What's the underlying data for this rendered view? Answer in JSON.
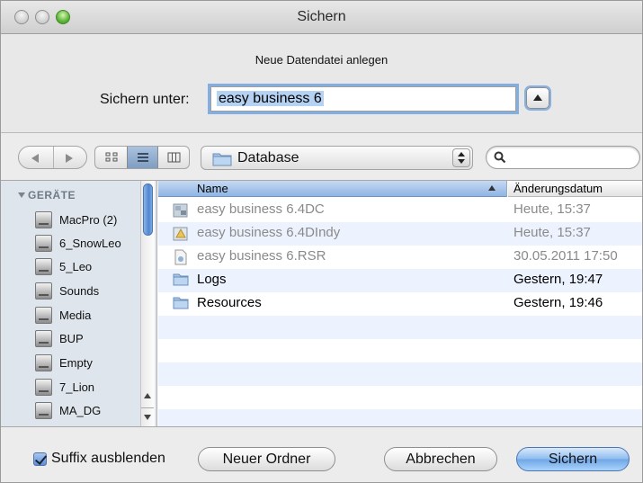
{
  "window": {
    "title": "Sichern"
  },
  "header": {
    "message": "Neue Datendatei anlegen",
    "save_as_label": "Sichern unter:",
    "save_as_value": "easy business 6"
  },
  "toolbar": {
    "view_icons": [
      "icon-view",
      "list-view",
      "column-view"
    ],
    "path_popup_label": "Database",
    "search_placeholder": ""
  },
  "sidebar": {
    "section_title": "GERÄTE",
    "items": [
      {
        "label": "MacPro (2)"
      },
      {
        "label": "6_SnowLeo"
      },
      {
        "label": "5_Leo"
      },
      {
        "label": "Sounds"
      },
      {
        "label": "Media"
      },
      {
        "label": "BUP"
      },
      {
        "label": "Empty"
      },
      {
        "label": "7_Lion"
      },
      {
        "label": "MA_DG"
      }
    ]
  },
  "file_list": {
    "columns": {
      "name": "Name",
      "date": "Änderungsdatum"
    },
    "rows": [
      {
        "name": "easy business 6.4DC",
        "date": "Heute, 15:37",
        "icon": "4d-component-icon",
        "enabled": false
      },
      {
        "name": "easy business 6.4DIndy",
        "date": "Heute, 15:37",
        "icon": "4d-indy-icon",
        "enabled": false
      },
      {
        "name": "easy business 6.RSR",
        "date": "30.05.2011 17:50",
        "icon": "resource-file-icon",
        "enabled": false
      },
      {
        "name": "Logs",
        "date": "Gestern, 19:47",
        "icon": "folder-icon",
        "enabled": true
      },
      {
        "name": "Resources",
        "date": "Gestern, 19:46",
        "icon": "folder-icon",
        "enabled": true
      }
    ]
  },
  "footer": {
    "hide_extension_label": "Suffix ausblenden",
    "hide_extension_checked": true,
    "new_folder_label": "Neuer Ordner",
    "cancel_label": "Abbrechen",
    "save_label": "Sichern"
  },
  "colors": {
    "accent": "#5c8ed6",
    "selection": "#b5d2f3",
    "alt_row": "#edf3fe",
    "sidebar_bg": "#dfe5ec"
  }
}
